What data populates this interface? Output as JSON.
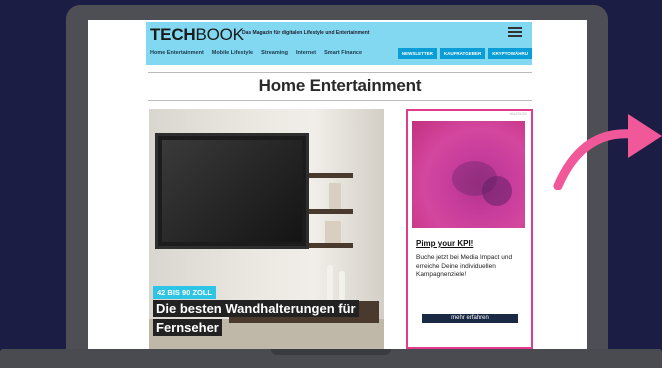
{
  "colors": {
    "background": "#1b1d45",
    "header": "#82d8f0",
    "accent_pink": "#e23a8c",
    "nav_button": "#0b9ed6",
    "kicker": "#2ec4e6"
  },
  "site": {
    "logo_bold": "TECH",
    "logo_light": "BOOK",
    "tagline": "Das Magazin für digitalen Lifestyle und Entertainment",
    "nav": [
      "Home Entertainment",
      "Mobile Lifestyle",
      "Streaming",
      "Internet",
      "Smart Finance"
    ],
    "buttons": [
      "NEWSLETTER",
      "KAUFRATGEBER",
      "KRYPTOWÄHRU"
    ]
  },
  "page": {
    "title": "Home Entertainment"
  },
  "article": {
    "kicker": "42 BIS 90 ZOLL",
    "headline": "Die besten Wandhalterungen für Fernseher"
  },
  "ad": {
    "label": "ANZEIGE",
    "title": "Pimp your KPI!",
    "text": "Buche jetzt bei Media Impact und erreiche Deine individuellen Kampagnenziele!",
    "button": "mehr erfahren"
  },
  "icons": {
    "arrow": "curved-arrow-icon",
    "menu": "menu-icon"
  }
}
